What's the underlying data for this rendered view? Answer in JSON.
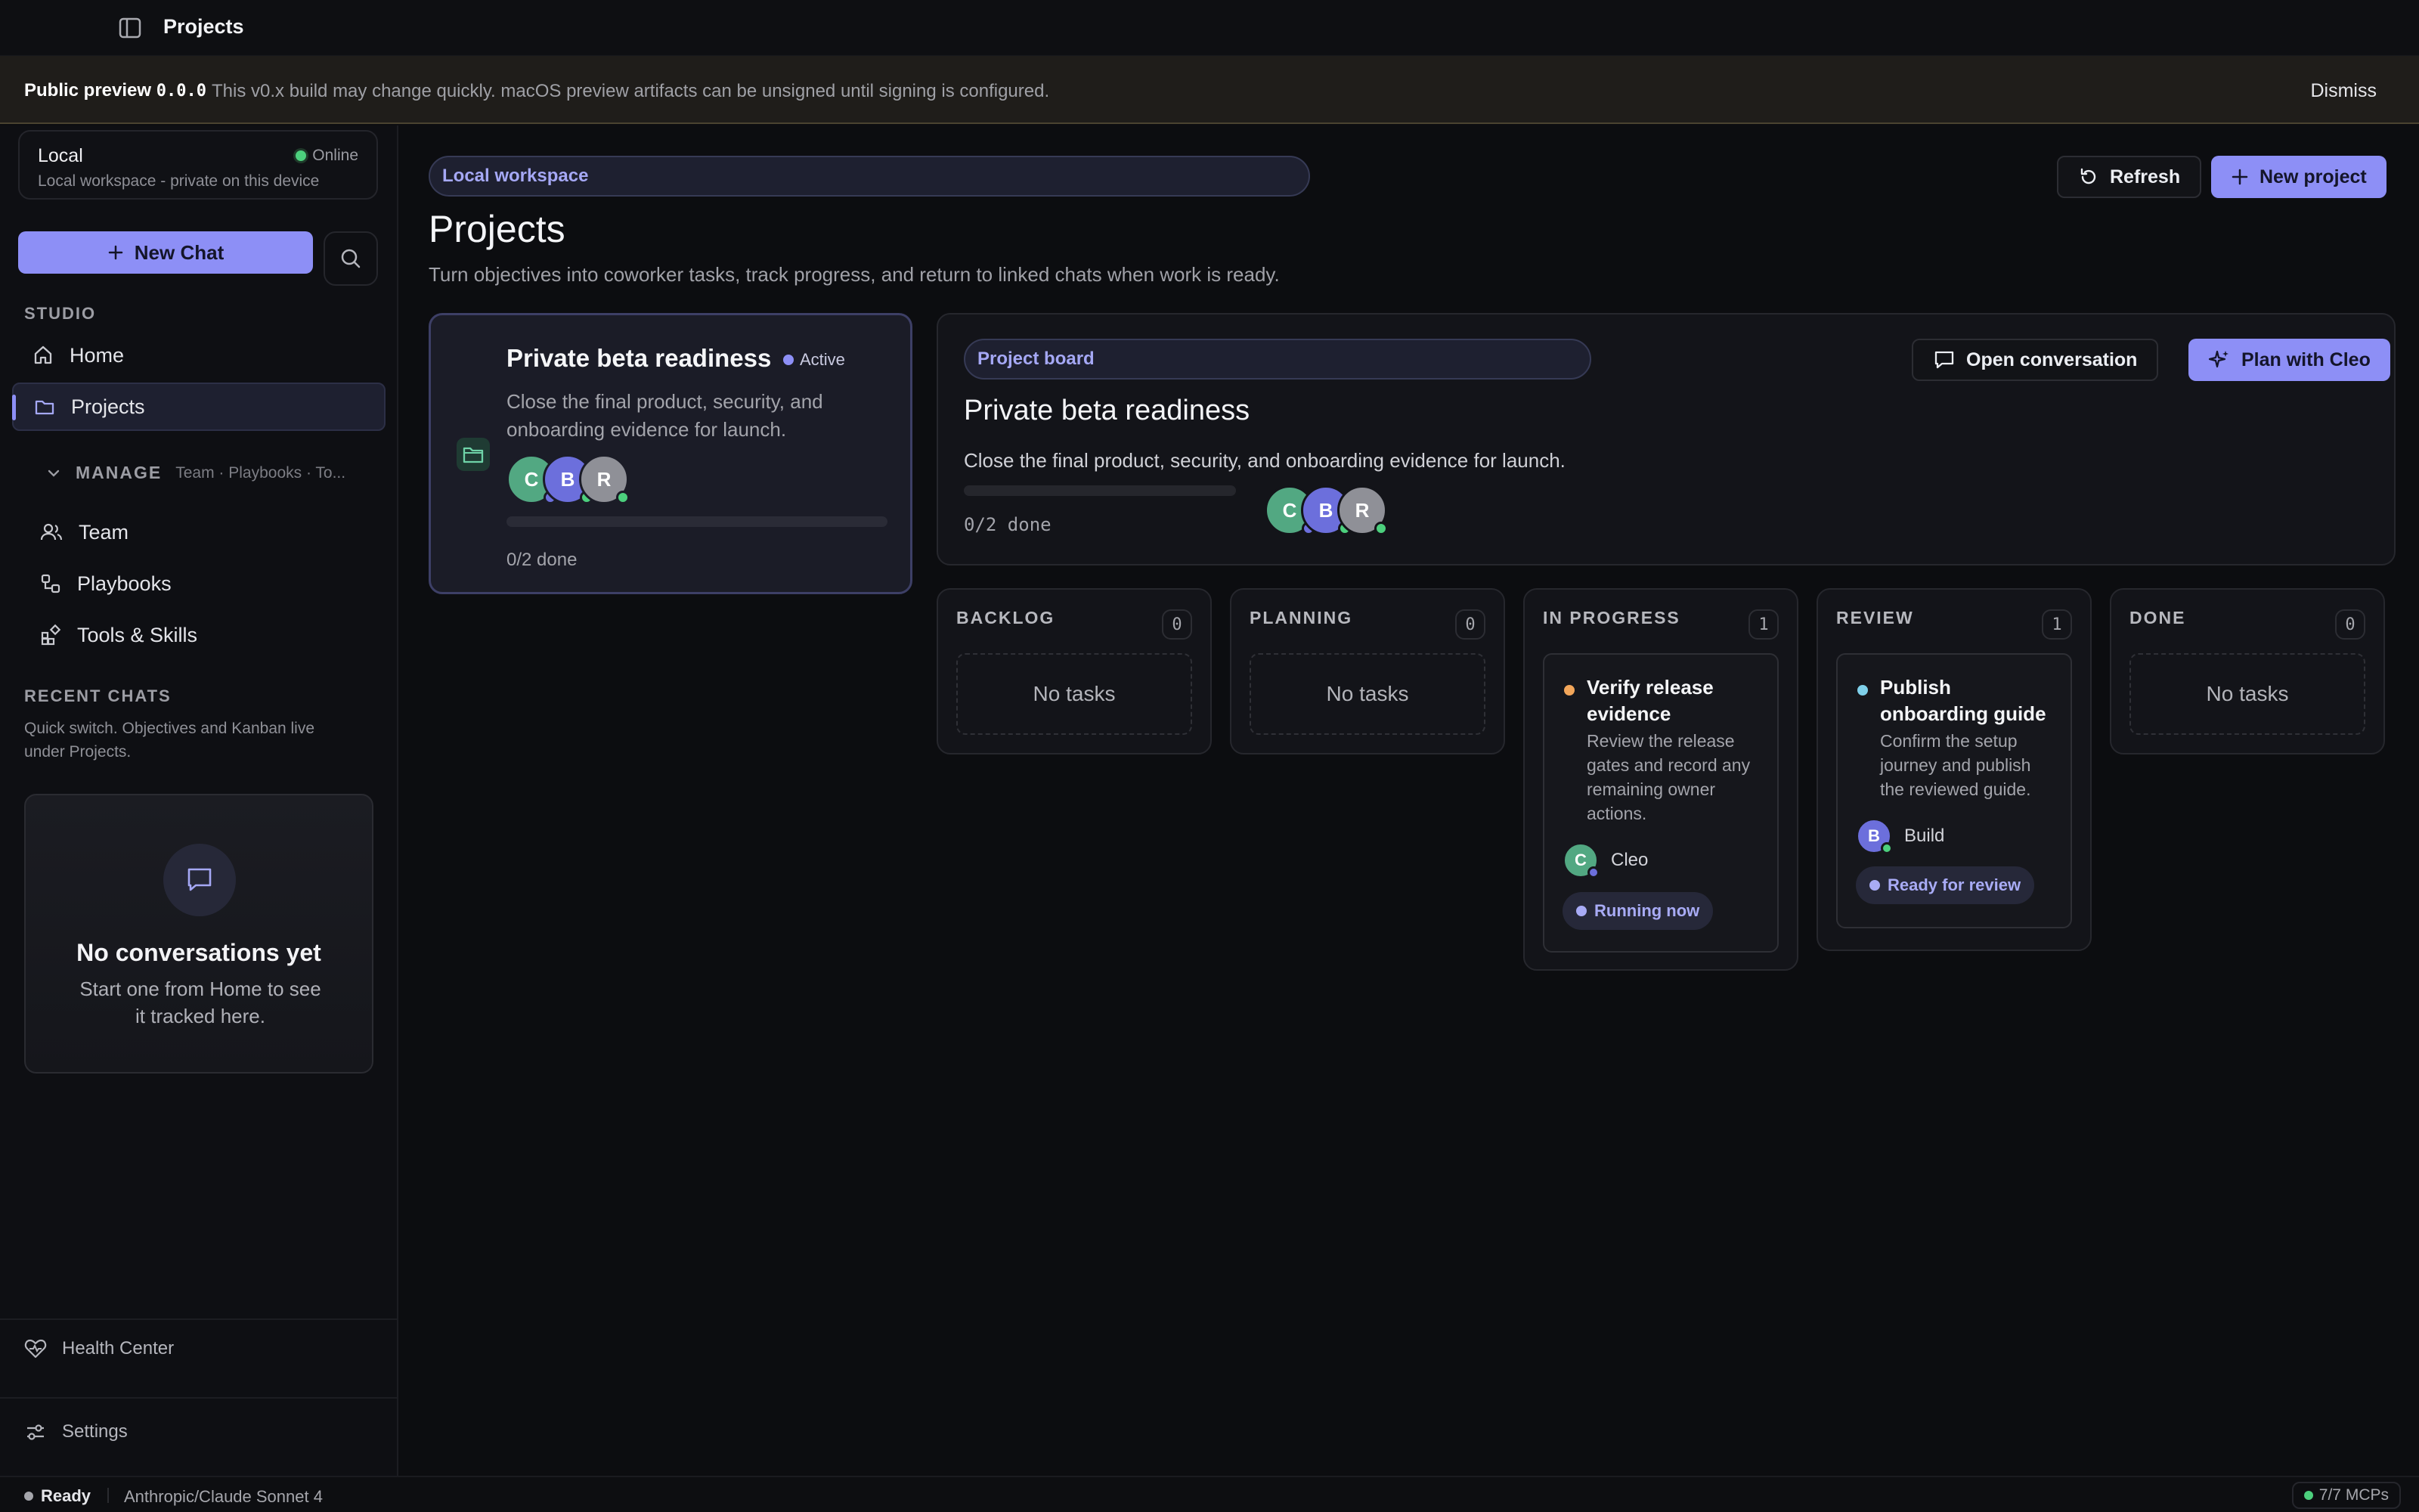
{
  "topbar": {
    "title": "Projects"
  },
  "banner": {
    "title": "Public preview",
    "version": "0.0.0",
    "message": "This v0.x build may change quickly. macOS preview artifacts can be unsigned until signing is configured.",
    "dismiss": "Dismiss"
  },
  "sidebar": {
    "workspace": {
      "name": "Local",
      "status": "Online",
      "description": "Local workspace - private on this device"
    },
    "new_chat": "New Chat",
    "studio_label": "STUDIO",
    "nav": [
      {
        "label": "Home",
        "icon": "home-icon"
      },
      {
        "label": "Projects",
        "icon": "folder-icon",
        "active": true
      }
    ],
    "manage": {
      "label": "MANAGE",
      "subtitle": "Team · Playbooks · To..."
    },
    "manage_items": [
      {
        "label": "Team",
        "icon": "users-icon"
      },
      {
        "label": "Playbooks",
        "icon": "playbooks-icon"
      },
      {
        "label": "Tools & Skills",
        "icon": "tools-icon"
      }
    ],
    "recent_label": "RECENT CHATS",
    "recent_desc": "Quick switch. Objectives and Kanban live under Projects.",
    "empty": {
      "title": "No conversations yet",
      "subtitle": "Start one from Home to see it tracked here."
    },
    "health": "Health Center",
    "settings": "Settings"
  },
  "statusbar": {
    "ready": "Ready",
    "model": "Anthropic/Claude Sonnet 4",
    "mcps": "7/7 MCPs"
  },
  "main": {
    "workspace_pill": "Local workspace",
    "refresh": "Refresh",
    "new_project": "New project",
    "title": "Projects",
    "subtitle": "Turn objectives into coworker tasks, track progress, and return to linked chats when work is ready.",
    "project": {
      "title": "Private beta readiness",
      "status": "Active",
      "description": "Close the final product, security, and onboarding evidence for launch.",
      "progress": 0,
      "done": "0/2 done",
      "avatars": [
        "C",
        "B",
        "R"
      ]
    },
    "board": {
      "pill": "Project board",
      "open_conversation": "Open conversation",
      "plan": "Plan with Cleo",
      "title": "Private beta readiness",
      "description": "Close the final product, security, and onboarding evidence for launch.",
      "done": "0/2 done"
    },
    "columns": [
      {
        "name": "BACKLOG",
        "count": "0",
        "empty": "No tasks"
      },
      {
        "name": "PLANNING",
        "count": "0",
        "empty": "No tasks"
      },
      {
        "name": "IN PROGRESS",
        "count": "1"
      },
      {
        "name": "REVIEW",
        "count": "1"
      },
      {
        "name": "DONE",
        "count": "0",
        "empty": "No tasks"
      }
    ],
    "tasks": [
      {
        "title": "Verify release evidence",
        "description": "Review the release gates and record any remaining owner actions.",
        "assignee_initial": "C",
        "assignee": "Cleo",
        "chip": "Running now",
        "dot_color": "#f2a65a"
      },
      {
        "title": "Publish onboarding guide",
        "description": "Confirm the setup journey and publish the reviewed guide.",
        "assignee_initial": "B",
        "assignee": "Build",
        "chip": "Ready for review",
        "dot_color": "#7fd0ea"
      }
    ]
  },
  "colors": {
    "accent": "#8d8ff6",
    "online": "#4cd07d",
    "bg": "#0c0d10"
  }
}
